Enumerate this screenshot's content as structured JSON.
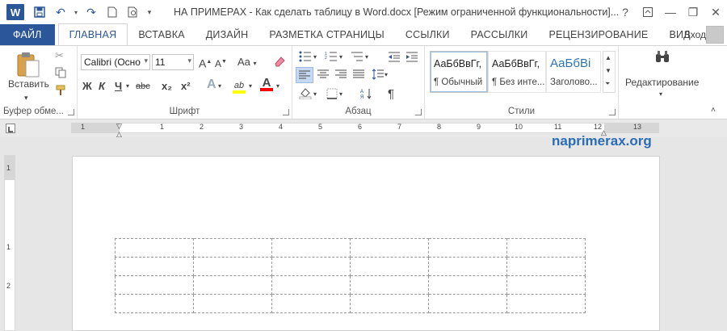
{
  "window": {
    "title": "НА ПРИМЕРАХ - Как сделать таблицу в Word.docx [Режим ограниченной функциональности]...",
    "help": "?",
    "minimize": "—",
    "restore": "❐",
    "close": "✕"
  },
  "quick_access": {
    "app_logo": "W",
    "save": "💾",
    "undo": "↶",
    "redo": "↷",
    "new": "🗋",
    "print_preview": "🔍"
  },
  "tabs": [
    {
      "label": "ФАЙЛ"
    },
    {
      "label": "ГЛАВНАЯ"
    },
    {
      "label": "ВСТАВКА"
    },
    {
      "label": "ДИЗАЙН"
    },
    {
      "label": "РАЗМЕТКА СТРАНИЦЫ"
    },
    {
      "label": "ССЫЛКИ"
    },
    {
      "label": "РАССЫЛКИ"
    },
    {
      "label": "РЕЦЕНЗИРОВАНИЕ"
    },
    {
      "label": "ВИД"
    }
  ],
  "account": {
    "signin": "Вход"
  },
  "ribbon": {
    "clipboard": {
      "label": "Буфер обме...",
      "paste": "Вставить"
    },
    "font": {
      "label": "Шрифт",
      "font_name": "Calibri (Осно",
      "font_size": "11",
      "grow": "A",
      "shrink": "A",
      "case": "Aa",
      "bold": "Ж",
      "italic": "К",
      "underline": "Ч",
      "strike": "abc",
      "sub": "x₂",
      "sup": "x²",
      "effects": "A",
      "highlight": "ab",
      "color": "A"
    },
    "paragraph": {
      "label": "Абзац",
      "pilcrow": "¶"
    },
    "styles": {
      "label": "Стили",
      "items": [
        {
          "sample": "АаБбВвГг,",
          "name": "¶ Обычный"
        },
        {
          "sample": "АаБбВвГг,",
          "name": "¶ Без инте..."
        },
        {
          "sample": "АаБбВі",
          "name": "Заголово..."
        }
      ]
    },
    "editing": {
      "label": "Редактирование"
    }
  },
  "ruler": {
    "marks": [
      "1",
      "1",
      "2",
      "3",
      "4",
      "5",
      "6",
      "7",
      "8",
      "9",
      "10",
      "11",
      "12",
      "13"
    ],
    "vmarks": [
      "1",
      "1",
      "2"
    ]
  },
  "document": {
    "watermark": "naprimerax.org",
    "table": {
      "rows": 4,
      "cols": 6
    }
  },
  "colors": {
    "accent": "#2b579a",
    "highlight": "#ffff00",
    "font_color": "#ff0000"
  }
}
